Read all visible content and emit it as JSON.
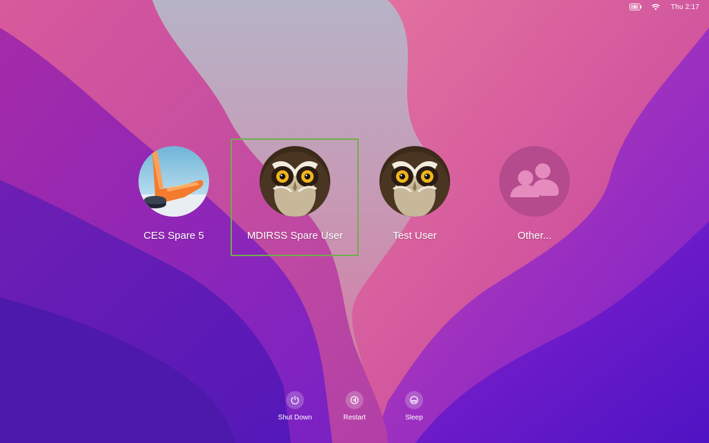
{
  "menubar": {
    "battery_icon": "battery-charging-icon",
    "wifi_icon": "wifi-icon",
    "clock": "Thu 2:17"
  },
  "users": [
    {
      "name": "CES Spare 5",
      "avatar": "hockey-stick-image"
    },
    {
      "name": "MDIRSS Spare User",
      "avatar": "owl-image",
      "selected": true
    },
    {
      "name": "Test User",
      "avatar": "owl-image"
    },
    {
      "name": "Other...",
      "avatar": "people-icon"
    }
  ],
  "power": {
    "shutdown_label": "Shut Down",
    "restart_label": "Restart",
    "sleep_label": "Sleep"
  },
  "colors": {
    "selection_border": "#6fae4a",
    "wallpaper_primary": "#7a22c4",
    "wallpaper_accent": "#d85a9a"
  }
}
